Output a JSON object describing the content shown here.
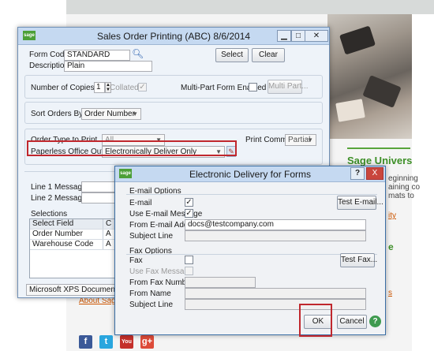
{
  "background": {
    "heading": "Sage Univers",
    "snippets": [
      "eginning",
      "aining co",
      "mats to"
    ],
    "links": [
      "ity",
      "s"
    ],
    "green_snippet": "e",
    "about_link": "About Sage",
    "social": [
      {
        "icon": "facebook-icon",
        "glyph": "f",
        "color": "#3b5998"
      },
      {
        "icon": "twitter-icon",
        "glyph": "t",
        "color": "#2aa6de"
      },
      {
        "icon": "youtube-icon",
        "glyph": "You",
        "color": "#c4302b"
      },
      {
        "icon": "googleplus-icon",
        "glyph": "g+",
        "color": "#dd4b39"
      }
    ]
  },
  "sales_window": {
    "title": "Sales Order Printing (ABC) 8/6/2014",
    "form_code_label": "Form Code",
    "form_code_value": "STANDARD",
    "description_label": "Description",
    "description_value": "Plain",
    "select_btn": "Select",
    "clear_btn": "Clear",
    "copies_label": "Number of Copies",
    "copies_value": "1",
    "collated_label": "Collated",
    "multipart_label": "Multi-Part Form Enabled",
    "multipart_btn": "Multi Part...",
    "sort_label": "Sort Orders By",
    "sort_value": "Order Number",
    "order_type_label": "Order Type to Print",
    "order_type_value": "All",
    "print_comments_label": "Print Comments",
    "print_comments_value": "Partial",
    "paperless_label": "Paperless Office Output",
    "paperless_value": "Electronically Deliver Only",
    "line1_label": "Line 1 Message",
    "line2_label": "Line 2 Message",
    "selections_label": "Selections",
    "grid_header": [
      "Select Field",
      "C"
    ],
    "grid_rows": [
      [
        "Order Number",
        "A"
      ],
      [
        "Warehouse Code",
        "A"
      ]
    ],
    "printer_value": "Microsoft XPS Document Writer"
  },
  "delivery_dialog": {
    "title": "Electronic Delivery for Forms",
    "help_btn": "?",
    "close_btn": "X",
    "email_group": "E-mail Options",
    "email_label": "E-mail",
    "use_email_msg_label": "Use E-mail Message",
    "from_email_label": "From E-mail Address",
    "from_email_value": "docs@testcompany.com",
    "subject_label": "Subject Line",
    "test_email_btn": "Test E-mail...",
    "fax_group": "Fax Options",
    "fax_label": "Fax",
    "use_fax_msg_label": "Use Fax Message",
    "from_fax_label": "From Fax Number",
    "from_name_label": "From Name",
    "fax_subject_label": "Subject Line",
    "test_fax_btn": "Test Fax...",
    "ok_btn": "OK",
    "cancel_btn": "Cancel"
  },
  "colors": {
    "highlight": "#c0272d",
    "sage_green": "#4c9f38",
    "titlebar": "#c5d9f1"
  }
}
